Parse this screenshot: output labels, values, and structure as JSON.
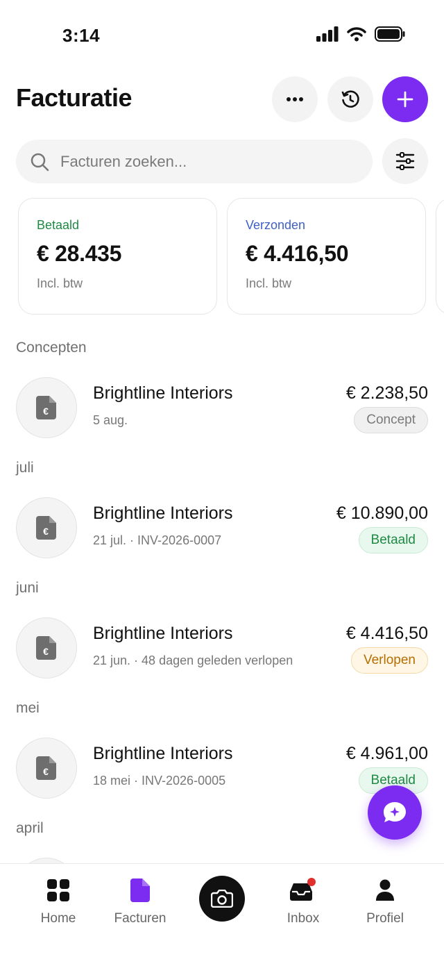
{
  "status_bar": {
    "time": "3:14"
  },
  "header": {
    "title": "Facturatie"
  },
  "search": {
    "placeholder": "Facturen zoeken..."
  },
  "summary_cards": [
    {
      "label": "Betaald",
      "amount": "€ 28.435",
      "sub": "Incl. btw",
      "color": "#1f8a44"
    },
    {
      "label": "Verzonden",
      "amount": "€ 4.416,50",
      "sub": "Incl. btw",
      "color": "#3f5fc4"
    }
  ],
  "sections": {
    "concepten": "Concepten",
    "juli": "juli",
    "juni": "juni",
    "mei": "mei",
    "april": "april"
  },
  "invoices": [
    {
      "client": "Brightline Interiors",
      "meta": "5 aug.",
      "amount": "€ 2.238,50",
      "status": "Concept"
    },
    {
      "client": "Brightline Interiors",
      "meta": "21 jul. · INV-2026-0007",
      "amount": "€ 10.890,00",
      "status": "Betaald"
    },
    {
      "client": "Brightline Interiors",
      "meta": "21 jun. · 48 dagen geleden verlopen",
      "amount": "€ 4.416,50",
      "status": "Verlopen"
    },
    {
      "client": "Brightline Interiors",
      "meta": "18 mei · INV-2026-0005",
      "amount": "€ 4.961,00",
      "status": "Betaald"
    }
  ],
  "nav": {
    "home": "Home",
    "facturen": "Facturen",
    "inbox": "Inbox",
    "profiel": "Profiel"
  },
  "colors": {
    "accent": "#7c2bf0",
    "paid": "#1f8a44",
    "overdue": "#b46f00",
    "sent": "#3f5fc4"
  },
  "icons": {
    "header": [
      "more-icon",
      "history-icon",
      "plus-icon"
    ],
    "search": "search-icon",
    "filter": "filter-icon",
    "invoice": "invoice-euro-icon",
    "fab": "assistant-chat-icon",
    "nav": [
      "home-grid-icon",
      "invoice-icon",
      "camera-icon",
      "inbox-icon",
      "profile-icon"
    ]
  }
}
